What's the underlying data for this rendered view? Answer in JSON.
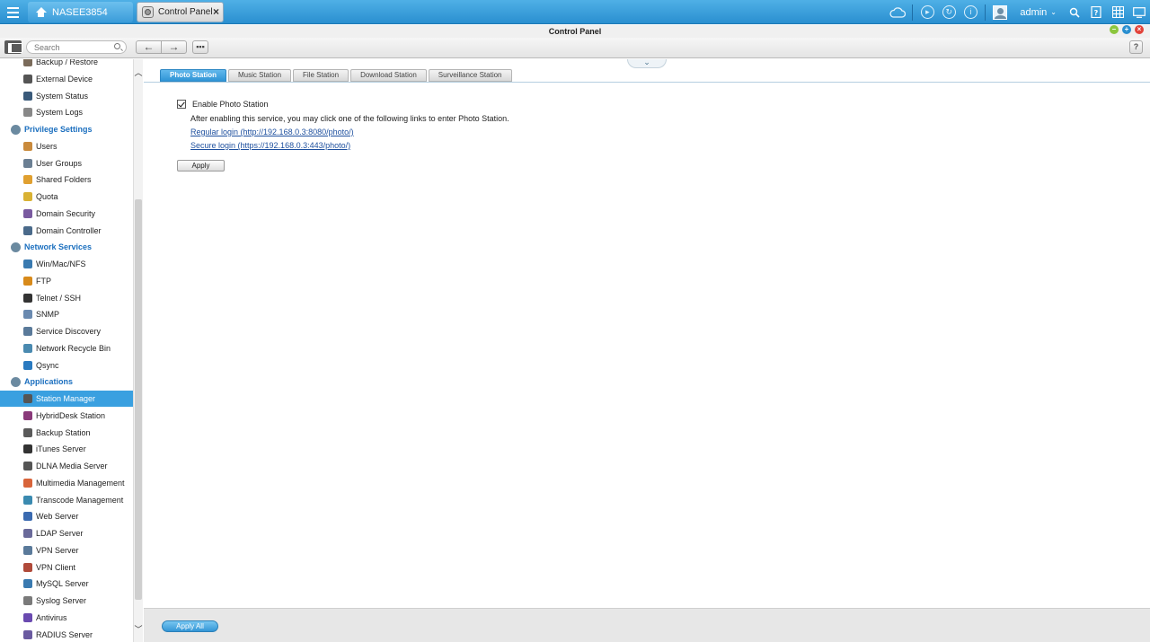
{
  "topbar": {
    "home_label": "NASEE3854",
    "tab_label": "Control Panel",
    "tab_close": "×",
    "user": "admin"
  },
  "window": {
    "title": "Control Panel"
  },
  "toolbar": {
    "search_placeholder": "Search",
    "back": "←",
    "forward": "→",
    "help": "?"
  },
  "sidebar": {
    "items": [
      {
        "label": "Backup / Restore",
        "type": "sub",
        "color": "#7a6b5a"
      },
      {
        "label": "External Device",
        "type": "sub",
        "color": "#555"
      },
      {
        "label": "System Status",
        "type": "sub",
        "color": "#3a5a7a"
      },
      {
        "label": "System Logs",
        "type": "sub",
        "color": "#888"
      },
      {
        "label": "Privilege Settings",
        "type": "cat"
      },
      {
        "label": "Users",
        "type": "sub",
        "color": "#c98a3c"
      },
      {
        "label": "User Groups",
        "type": "sub",
        "color": "#6b7f93"
      },
      {
        "label": "Shared Folders",
        "type": "sub",
        "color": "#e0a030"
      },
      {
        "label": "Quota",
        "type": "sub",
        "color": "#d9b234"
      },
      {
        "label": "Domain Security",
        "type": "sub",
        "color": "#7a5aa0"
      },
      {
        "label": "Domain Controller",
        "type": "sub",
        "color": "#4a6a8a"
      },
      {
        "label": "Network Services",
        "type": "cat"
      },
      {
        "label": "Win/Mac/NFS",
        "type": "sub",
        "color": "#3a7ab0"
      },
      {
        "label": "FTP",
        "type": "sub",
        "color": "#d88a1a"
      },
      {
        "label": "Telnet / SSH",
        "type": "sub",
        "color": "#333"
      },
      {
        "label": "SNMP",
        "type": "sub",
        "color": "#6a8ab0"
      },
      {
        "label": "Service Discovery",
        "type": "sub",
        "color": "#5a7a9a"
      },
      {
        "label": "Network Recycle Bin",
        "type": "sub",
        "color": "#4a8ab0"
      },
      {
        "label": "Qsync",
        "type": "sub",
        "color": "#2a7ac0"
      },
      {
        "label": "Applications",
        "type": "cat"
      },
      {
        "label": "Station Manager",
        "type": "sub",
        "color": "#555",
        "active": true
      },
      {
        "label": "HybridDesk Station",
        "type": "sub",
        "color": "#8a3a7a"
      },
      {
        "label": "Backup Station",
        "type": "sub",
        "color": "#5a5a5a"
      },
      {
        "label": "iTunes Server",
        "type": "sub",
        "color": "#333"
      },
      {
        "label": "DLNA Media Server",
        "type": "sub",
        "color": "#555"
      },
      {
        "label": "Multimedia Management",
        "type": "sub",
        "color": "#d8643a"
      },
      {
        "label": "Transcode Management",
        "type": "sub",
        "color": "#3a8ab0"
      },
      {
        "label": "Web Server",
        "type": "sub",
        "color": "#3a6ab0"
      },
      {
        "label": "LDAP Server",
        "type": "sub",
        "color": "#6a6a9a"
      },
      {
        "label": "VPN Server",
        "type": "sub",
        "color": "#5a7a9a"
      },
      {
        "label": "VPN Client",
        "type": "sub",
        "color": "#b04a3a"
      },
      {
        "label": "MySQL Server",
        "type": "sub",
        "color": "#3a7ab0"
      },
      {
        "label": "Syslog Server",
        "type": "sub",
        "color": "#7a7a7a"
      },
      {
        "label": "Antivirus",
        "type": "sub",
        "color": "#6a4ab0"
      },
      {
        "label": "RADIUS Server",
        "type": "sub",
        "color": "#6a5aa0"
      }
    ]
  },
  "main": {
    "tabs": [
      {
        "label": "Photo Station",
        "active": true
      },
      {
        "label": "Music Station"
      },
      {
        "label": "File Station"
      },
      {
        "label": "Download Station"
      },
      {
        "label": "Surveillance Station"
      }
    ],
    "enable_label": "Enable Photo Station",
    "enable_checked": true,
    "description": "After enabling this service, you may click one of the following links to enter Photo Station.",
    "regular_login": "Regular login (http://192.168.0.3:8080/photo/)",
    "secure_login": "Secure login (https://192.168.0.3:443/photo/)",
    "apply": "Apply"
  },
  "footer": {
    "apply_all": "Apply All"
  },
  "colors": {
    "accent": "#2a8fd0",
    "active_item": "#3aa0e0",
    "category": "#1b6fbf",
    "link": "#1d4f9e"
  }
}
